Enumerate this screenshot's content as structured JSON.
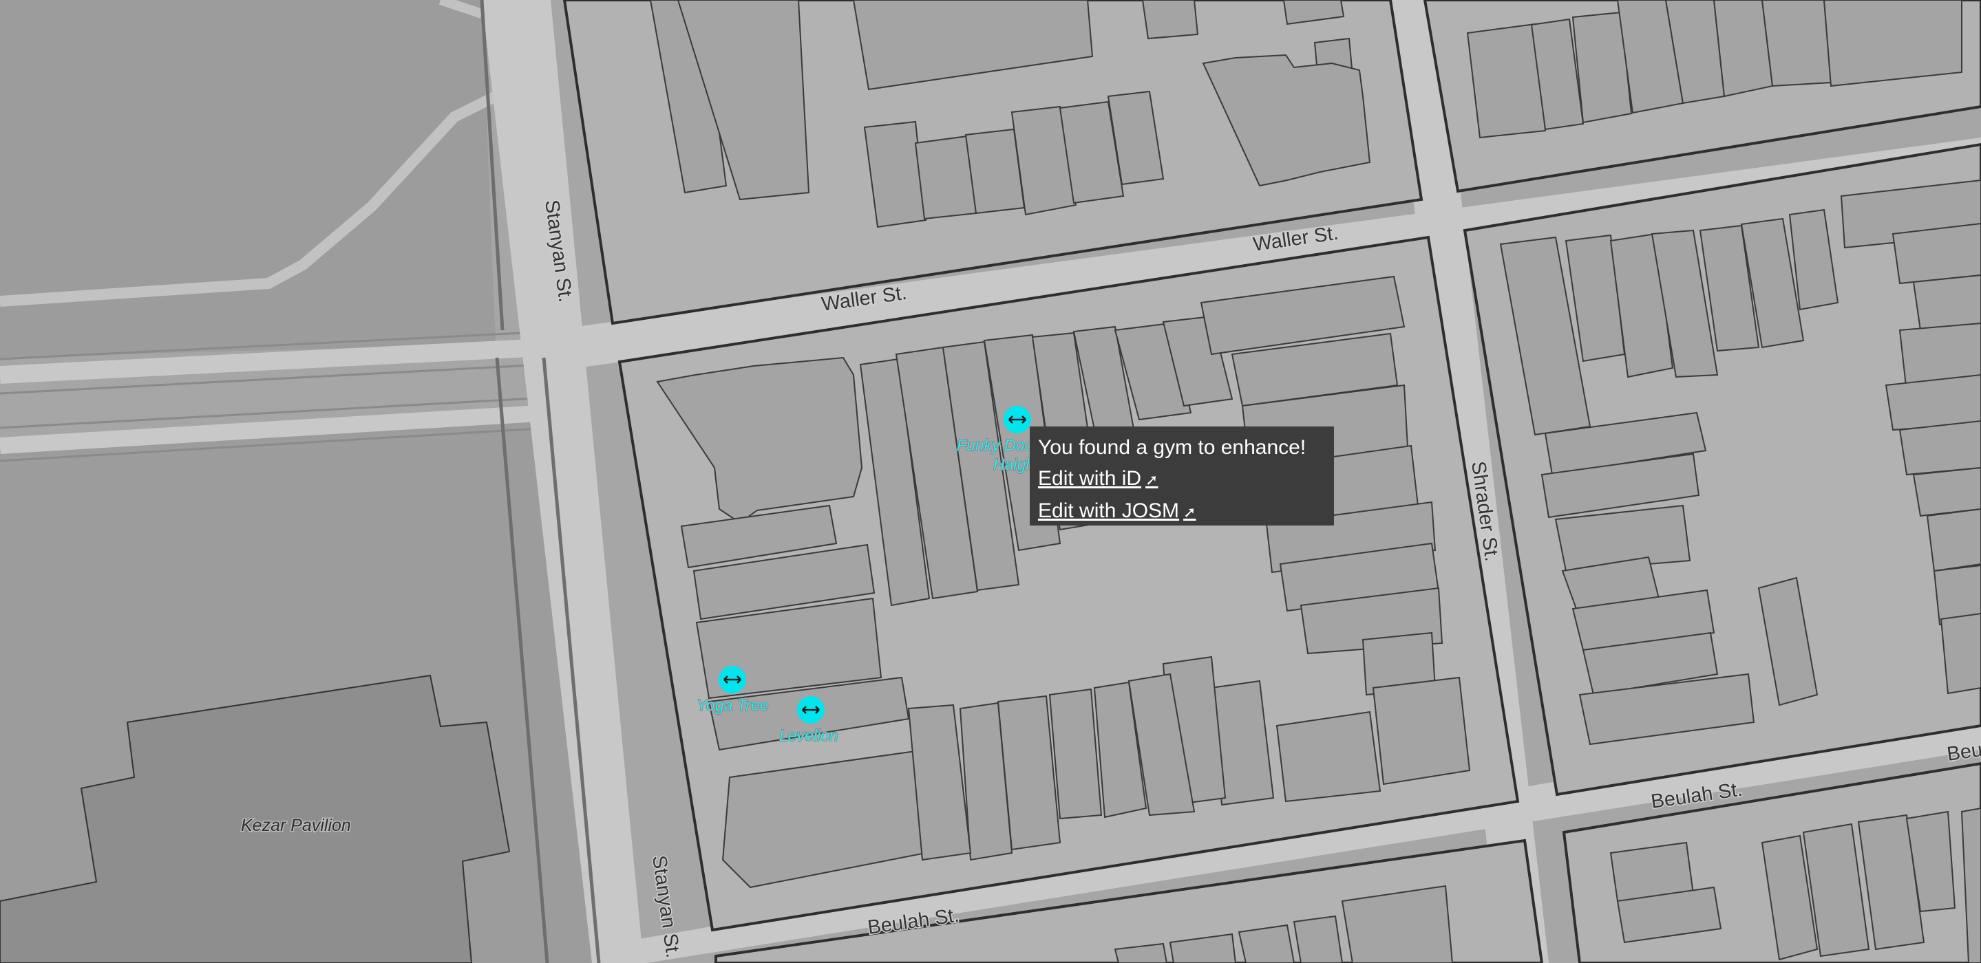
{
  "map": {
    "streets": {
      "waller_west": "Waller St.",
      "waller_east": "Waller St.",
      "stanyan_north": "Stanyan St.",
      "stanyan_south": "Stanyan St.",
      "shrader": "Shrader St.",
      "beulah_west": "Beulah St.",
      "beulah_mid": "Beulah St.",
      "beulah_east": "Beu"
    },
    "places": {
      "pavilion": "Kezar Pavilion"
    },
    "gyms": [
      {
        "name": "Funky Door Yoga Haight",
        "label_line1": "Funky Door",
        "label_line2": "Haight"
      },
      {
        "name": "Yoga Tree",
        "label_line1": "Yoga Tree"
      },
      {
        "name": "Levelion",
        "label_line1": "Levelion"
      }
    ],
    "colors": {
      "background": "#a9a9a9",
      "park": "#9c9c9c",
      "pavilion": "#8e8e8e",
      "road": "#c8c8c8",
      "block": "#b4b4b4",
      "gym_marker": "#00e5ee",
      "popup_bg": "#3c3c3c"
    }
  },
  "popup": {
    "title": "You found a gym to enhance!",
    "link_id": "Edit with iD",
    "link_josm": "Edit with JOSM",
    "external_icon": "external-link-icon"
  }
}
